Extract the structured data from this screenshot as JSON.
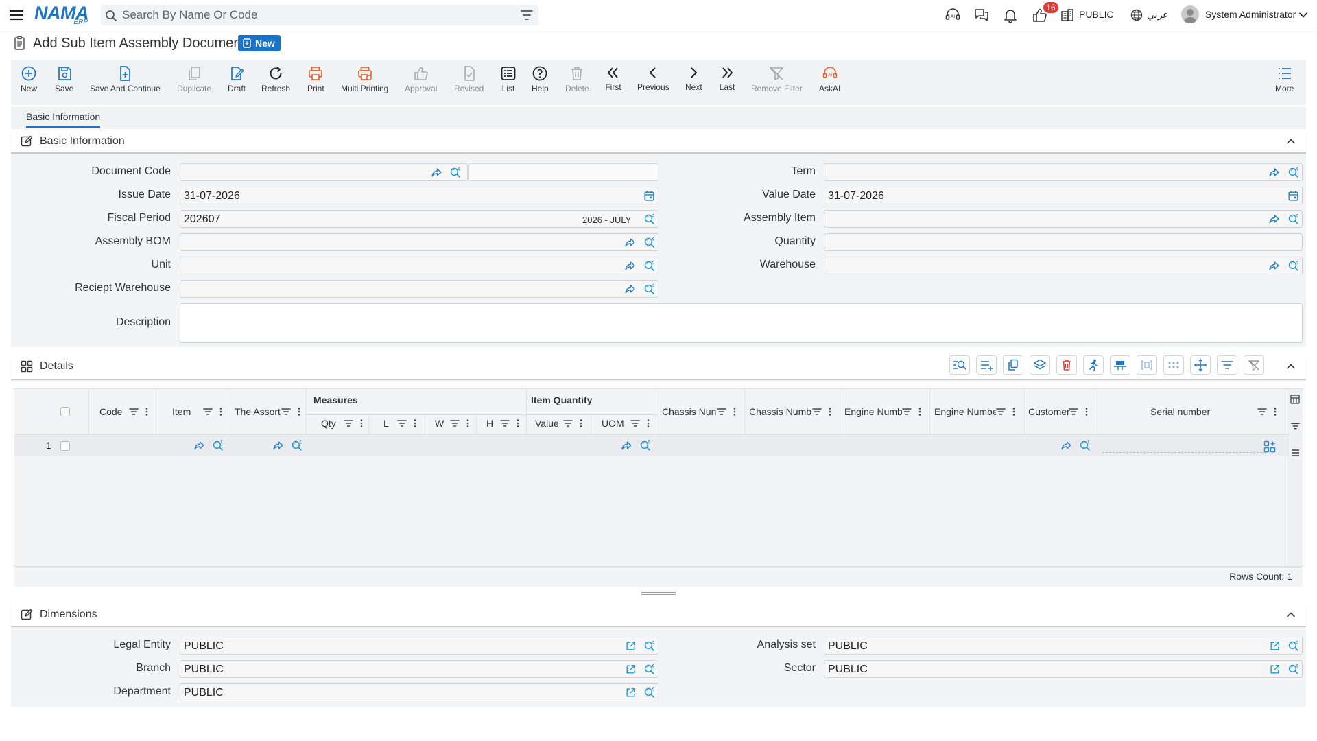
{
  "topbar": {
    "logo_text": "NAMA",
    "logo_sub": "ERP",
    "search_placeholder": "Search By Name Or Code",
    "notification_count": "16",
    "company": "PUBLIC",
    "language": "عربي",
    "user": "System Administrator"
  },
  "page": {
    "title": "Add Sub Item Assembly Document",
    "badge": "New"
  },
  "toolbar": {
    "new": "New",
    "save": "Save",
    "save_continue": "Save And Continue",
    "duplicate": "Duplicate",
    "draft": "Draft",
    "refresh": "Refresh",
    "print": "Print",
    "multi_printing": "Multi Printing",
    "approval": "Approval",
    "revised": "Revised",
    "list": "List",
    "help": "Help",
    "delete": "Delete",
    "first": "First",
    "previous": "Previous",
    "next": "Next",
    "last": "Last",
    "remove_filter": "Remove Filter",
    "askai": "AskAI",
    "more": "More"
  },
  "tabs": {
    "basic": "Basic Information"
  },
  "basic": {
    "title": "Basic Information",
    "document_code_label": "Document Code",
    "document_code": "",
    "issue_date_label": "Issue Date",
    "issue_date": "31-07-2026",
    "fiscal_period_label": "Fiscal Period",
    "fiscal_period": "202607",
    "fiscal_period_name": "2026 - JULY",
    "assembly_bom_label": "Assembly BOM",
    "unit_label": "Unit",
    "receipt_warehouse_label": "Reciept Warehouse",
    "description_label": "Description",
    "term_label": "Term",
    "value_date_label": "Value Date",
    "value_date": "31-07-2026",
    "assembly_item_label": "Assembly Item",
    "quantity_label": "Quantity",
    "warehouse_label": "Warehouse"
  },
  "details": {
    "title": "Details",
    "columns": {
      "code": "Code",
      "item": "Item",
      "assortment": "The Assort",
      "measures": "Measures",
      "qty": "Qty",
      "l": "L",
      "w": "W",
      "h": "H",
      "item_quantity": "Item Quantity",
      "value": "Value",
      "uom": "UOM",
      "chassis1": "Chassis Nun",
      "chassis2": "Chassis Numb",
      "engine1": "Engine Numb",
      "engine2": "Engine Numbe",
      "customer": "Customer",
      "serial": "Serial number"
    },
    "row_number": "1",
    "rows_count": "Rows Count: 1"
  },
  "dimensions": {
    "title": "Dimensions",
    "legal_entity_label": "Legal Entity",
    "legal_entity": "PUBLIC",
    "branch_label": "Branch",
    "branch": "PUBLIC",
    "department_label": "Department",
    "department": "PUBLIC",
    "analysis_set_label": "Analysis set",
    "analysis_set": "PUBLIC",
    "sector_label": "Sector",
    "sector": "PUBLIC"
  },
  "colors": {
    "accent": "#1b76c8",
    "icon_teal": "#2a8fd6",
    "print_orange": "#e8642c",
    "badge_red": "#e53935"
  }
}
